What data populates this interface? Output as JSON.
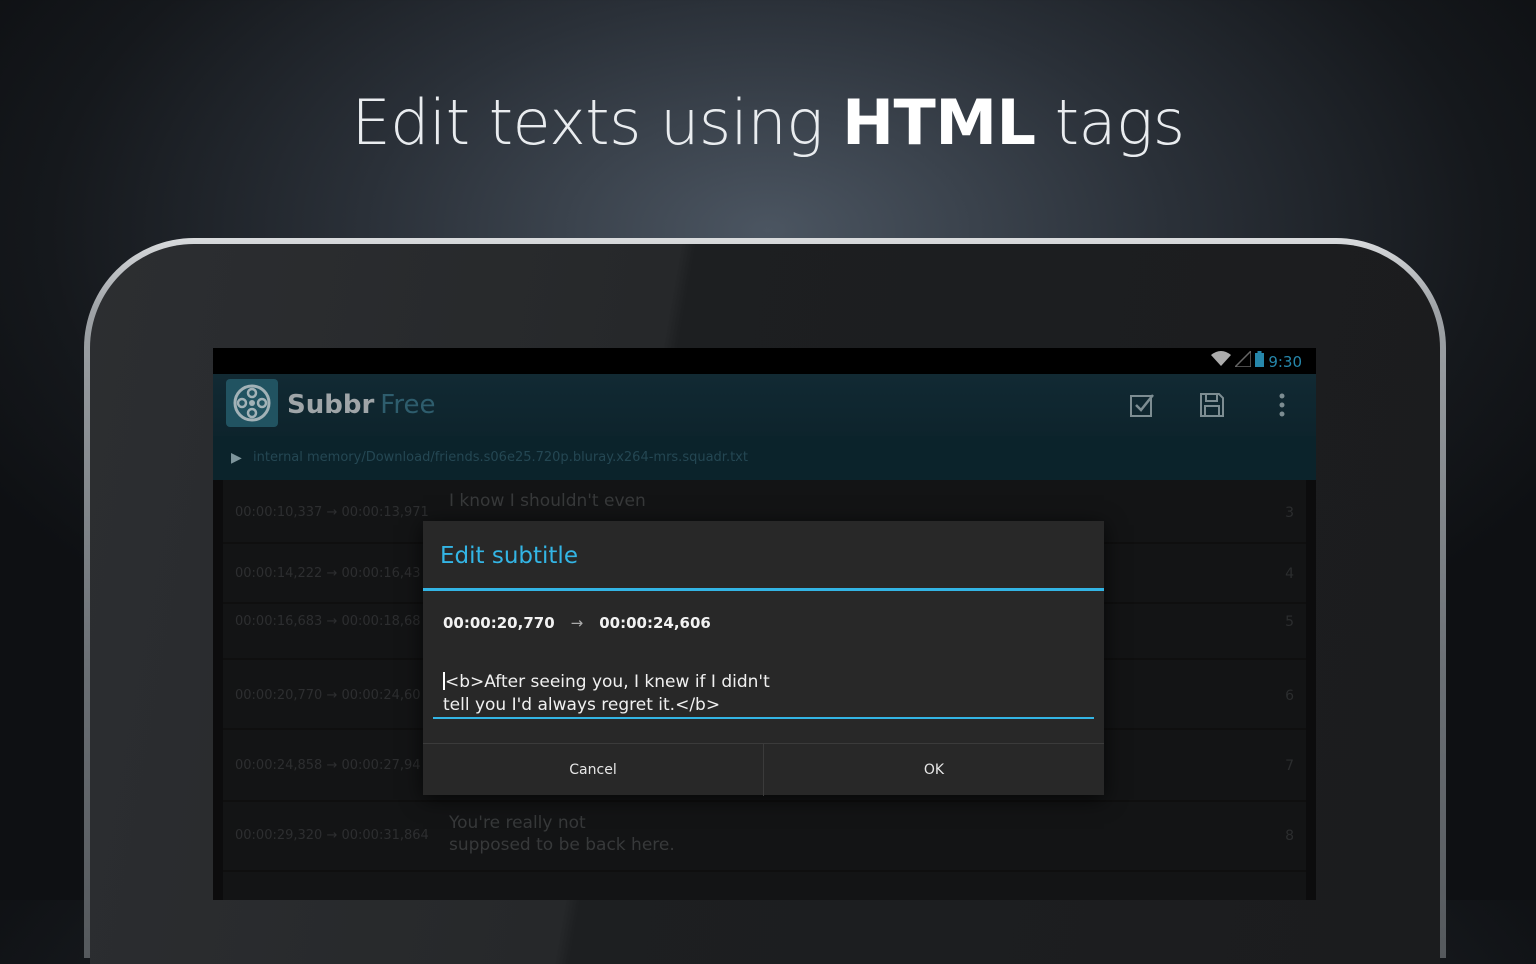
{
  "headline": {
    "prefix": "Edit texts using",
    "bold": "HTML",
    "suffix": "tags"
  },
  "status": {
    "time": "9:30",
    "icons": [
      "wifi-icon",
      "signal-icon",
      "battery-icon"
    ]
  },
  "actionbar": {
    "app_name": "Subbr",
    "app_edition": "Free",
    "actions": [
      "select-all-icon",
      "save-icon",
      "overflow-menu-icon"
    ]
  },
  "path": "internal memory/Download/friends.s06e25.720p.bluray.x264-mrs.squadr.txt",
  "subtitles": [
    {
      "time": "00:00:10,337 → 00:00:13,971",
      "text": "I know I shouldn't even",
      "num": "3"
    },
    {
      "time": "00:00:14,222 → 00:00:16,43",
      "text": "",
      "num": "4"
    },
    {
      "time": "00:00:16,683 → 00:00:18,68",
      "text": "",
      "num": "5"
    },
    {
      "time": "00:00:20,770 → 00:00:24,60",
      "text": "",
      "num": "6"
    },
    {
      "time": "00:00:24,858 → 00:00:27,94",
      "text": "",
      "num": "7"
    },
    {
      "time": "00:00:29,320 → 00:00:31,864",
      "text": "You're really not\nsupposed to be back here.",
      "num": "8"
    }
  ],
  "dialog": {
    "title": "Edit subtitle",
    "start": "00:00:20,770",
    "arrow": "→",
    "end": "00:00:24,606",
    "text_line1": "<b>After seeing you, I knew if I didn't",
    "text_line2": "tell you I'd always regret it.</b>",
    "cancel": "Cancel",
    "ok": "OK"
  },
  "colors": {
    "accent": "#33b5e5",
    "actionbar": "#12303b"
  }
}
